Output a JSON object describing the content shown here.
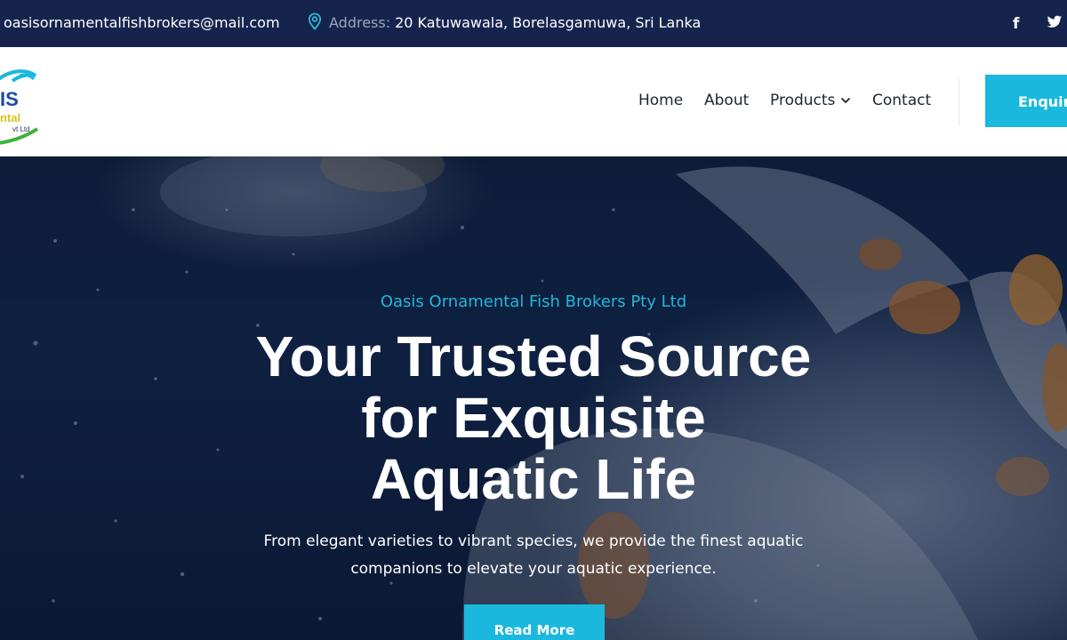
{
  "topbar": {
    "email": "oasisornamentalfishbrokers@mail.com",
    "address_label": "Address:",
    "address_value": "20 Katuwawala, Borelasgamuwa, Sri Lanka",
    "icons": [
      "location-pin-icon",
      "facebook-icon",
      "twitter-icon"
    ]
  },
  "header": {
    "logo_text": [
      "IS",
      "ntal",
      "vt Ltd"
    ],
    "nav": {
      "home": "Home",
      "about": "About",
      "products": "Products",
      "contact": "Contact"
    },
    "enquire_label": "Enquire"
  },
  "hero": {
    "tagline": "Oasis Ornamental Fish Brokers Pty Ltd",
    "headline_lines": [
      "Your Trusted Source",
      "for Exquisite",
      "Aquatic Life"
    ],
    "subtext_lines": [
      "From elegant varieties to vibrant species, we provide the finest aquatic",
      "companions to elevate your aquatic experience."
    ],
    "cta_label": "Read More"
  },
  "colors": {
    "topbar_bg": "#16244d",
    "accent": "#1bb8dd",
    "tagline": "#24b6d9",
    "nav_text": "#1e2530"
  }
}
